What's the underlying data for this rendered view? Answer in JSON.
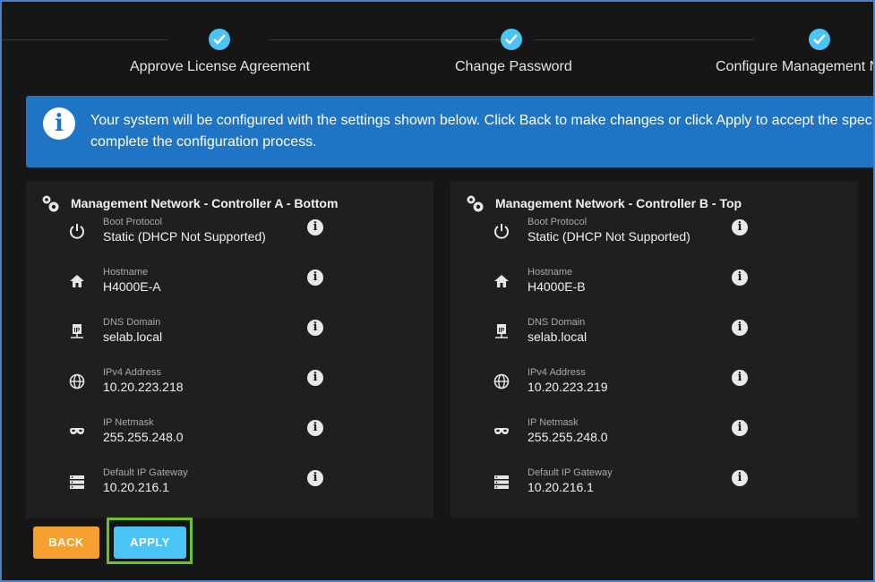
{
  "stepper": {
    "steps": [
      {
        "label": "Approve License Agreement",
        "done": true
      },
      {
        "label": "Change Password",
        "done": true
      },
      {
        "label": "Configure Management N",
        "done": true
      }
    ]
  },
  "banner": {
    "icon": "info-icon",
    "text": "Your system will be configured with the settings shown below. Click Back to make changes or click Apply to accept the spec complete the configuration process."
  },
  "cards": [
    {
      "title": "Management Network - Controller A - Bottom",
      "rows": [
        {
          "label": "Boot Protocol",
          "value": "Static (DHCP Not Supported)",
          "icon": "power-icon"
        },
        {
          "label": "Hostname",
          "value": "H4000E-A",
          "icon": "home-icon"
        },
        {
          "label": "DNS Domain",
          "value": "selab.local",
          "icon": "dns-icon"
        },
        {
          "label": "IPv4 Address",
          "value": "10.20.223.218",
          "icon": "globe-icon"
        },
        {
          "label": "IP Netmask",
          "value": "255.255.248.0",
          "icon": "mask-icon"
        },
        {
          "label": "Default IP Gateway",
          "value": "10.20.216.1",
          "icon": "server-icon"
        }
      ]
    },
    {
      "title": "Management Network - Controller B - Top",
      "rows": [
        {
          "label": "Boot Protocol",
          "value": "Static (DHCP Not Supported)",
          "icon": "power-icon"
        },
        {
          "label": "Hostname",
          "value": "H4000E-B",
          "icon": "home-icon"
        },
        {
          "label": "DNS Domain",
          "value": "selab.local",
          "icon": "dns-icon"
        },
        {
          "label": "IPv4 Address",
          "value": "10.20.223.219",
          "icon": "globe-icon"
        },
        {
          "label": "IP Netmask",
          "value": "255.255.248.0",
          "icon": "mask-icon"
        },
        {
          "label": "Default IP Gateway",
          "value": "10.20.216.1",
          "icon": "server-icon"
        }
      ]
    }
  ],
  "buttons": {
    "back_label": "BACK",
    "apply_label": "APPLY"
  },
  "colors": {
    "accent": "#4cc3f5",
    "banner": "#1f74c4",
    "back": "#f5a030",
    "highlight": "#6cc02a"
  }
}
